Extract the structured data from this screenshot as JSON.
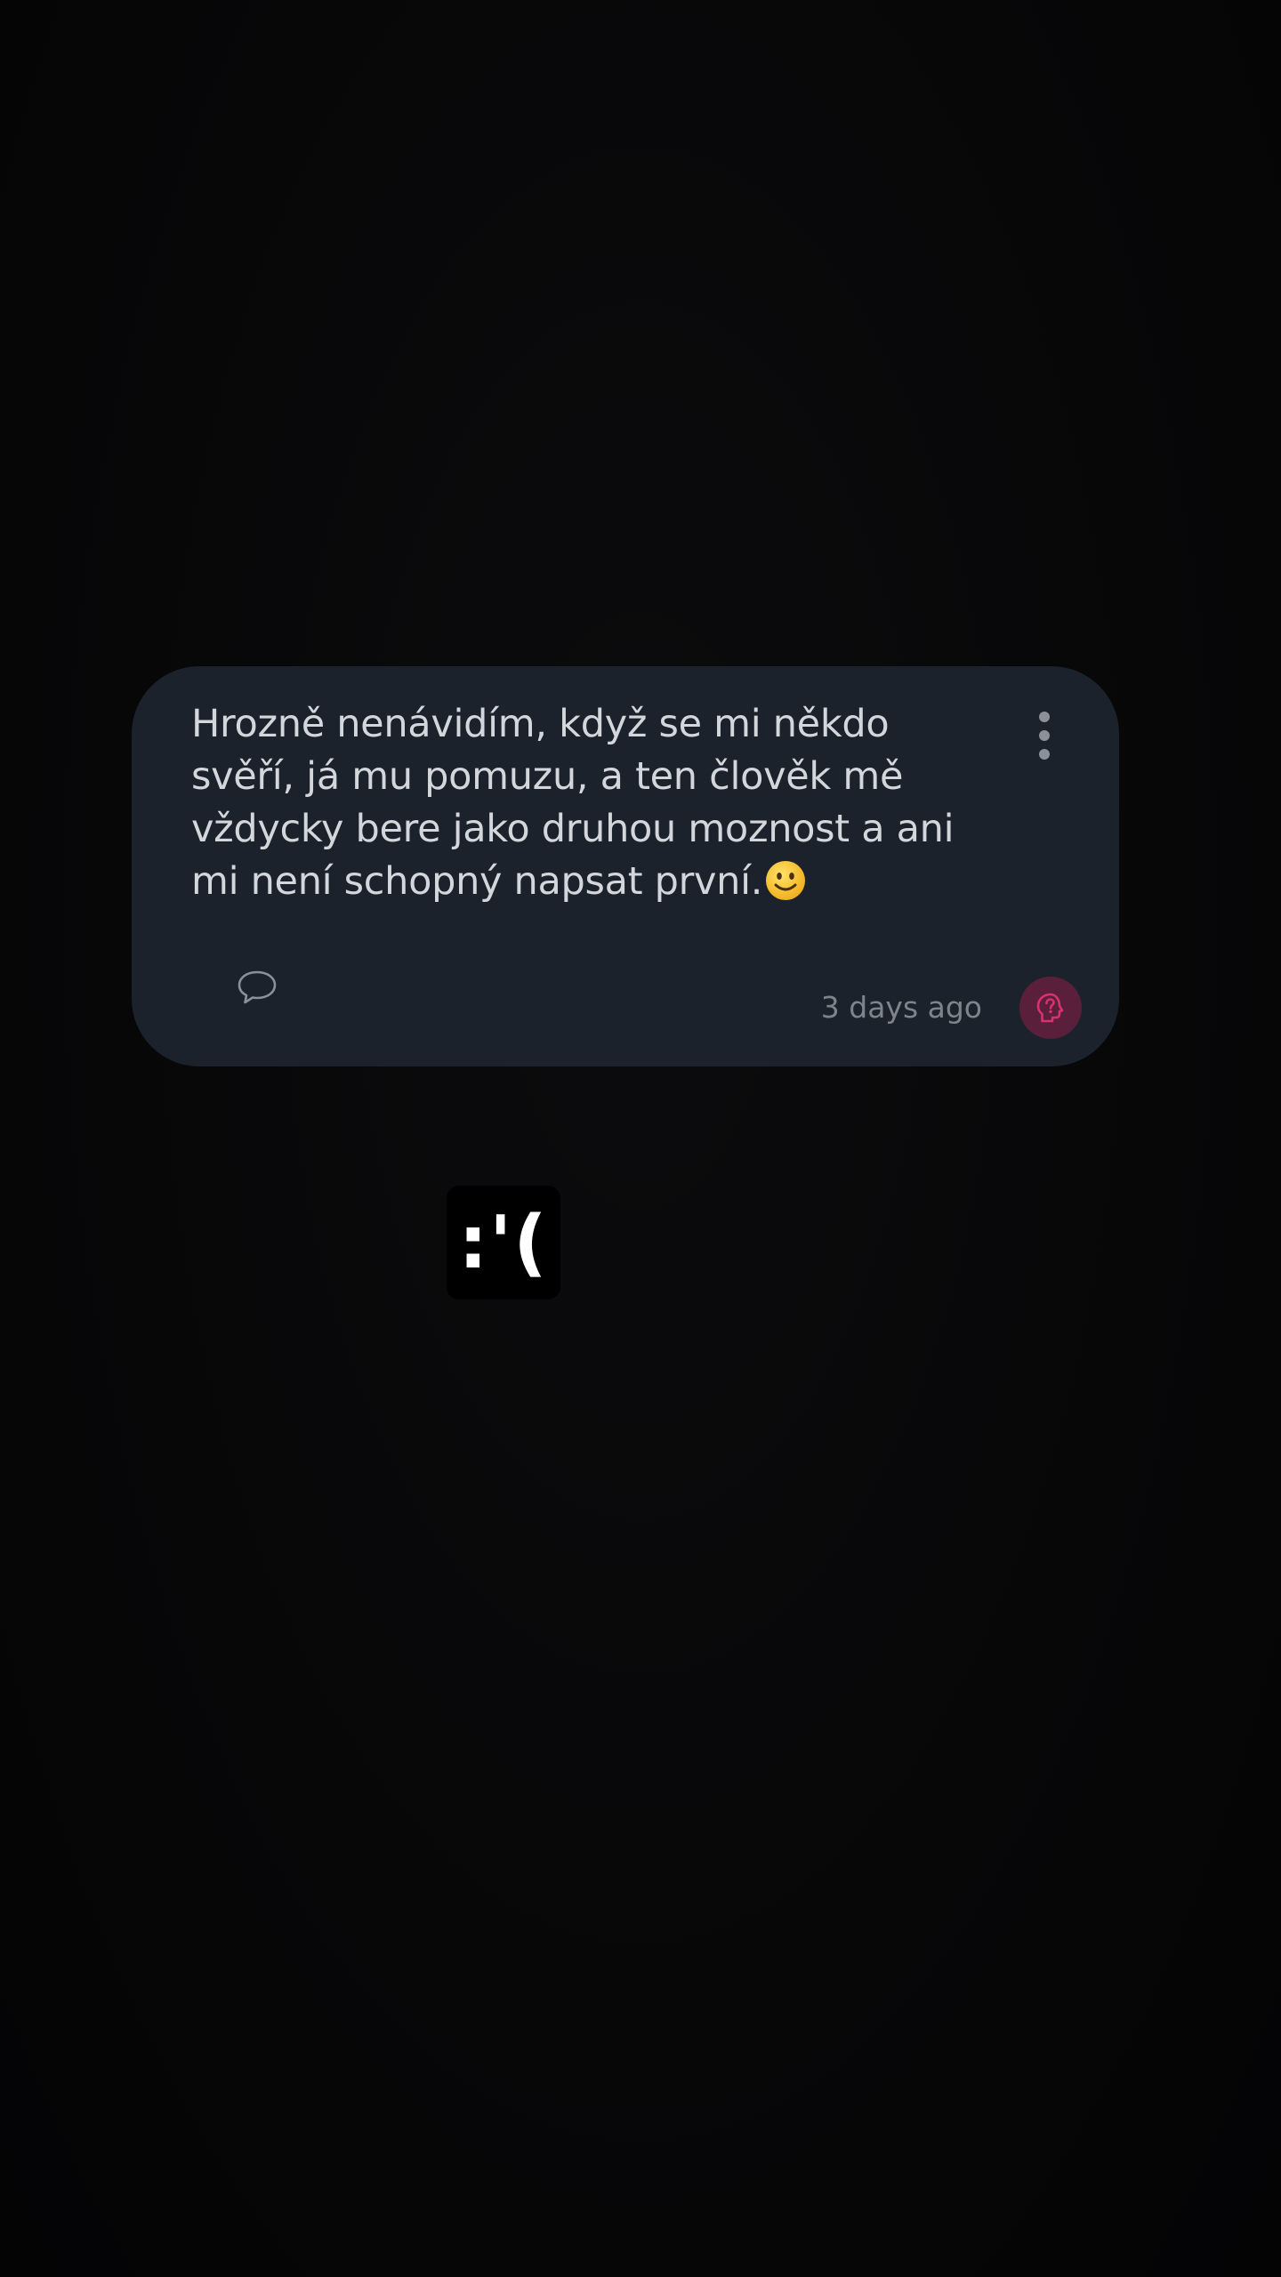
{
  "post": {
    "text": "Hrozně nenávidím, když se mi někdo svěří, já mu pomuzu, a ten člověk mě vždycky bere jako druhou moznost a ani mi není schopný napsat první.",
    "trailing_emoji": "slightly-smiling-face",
    "timestamp": "3 days ago",
    "icons": {
      "more": "more-vertical-icon",
      "comment": "comment-bubble-icon",
      "help": "help-head-icon"
    },
    "colors": {
      "card_background": "#1c222b",
      "text": "#d3d6db",
      "muted": "#7f848c",
      "accent": "#d6336c",
      "accent_background": "#5a1f3a"
    }
  },
  "reaction_sticker": {
    "text": ":'("
  }
}
